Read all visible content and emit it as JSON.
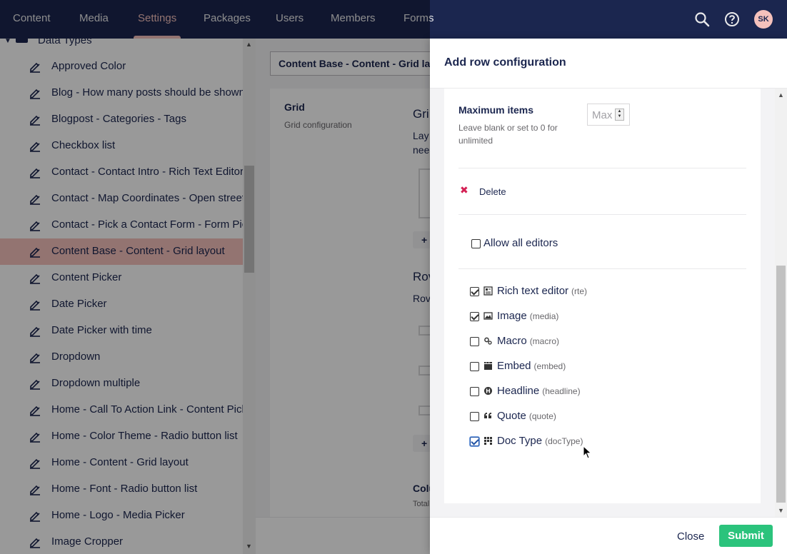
{
  "topnav": {
    "items": [
      {
        "label": "Content"
      },
      {
        "label": "Media"
      },
      {
        "label": "Settings"
      },
      {
        "label": "Packages"
      },
      {
        "label": "Users"
      },
      {
        "label": "Members"
      },
      {
        "label": "Forms"
      }
    ],
    "active": "Settings",
    "user_initials": "SK"
  },
  "tree": {
    "root_label": "Data Types",
    "items": [
      {
        "label": "Approved Color"
      },
      {
        "label": "Blog - How many posts should be shown"
      },
      {
        "label": "Blogpost - Categories - Tags"
      },
      {
        "label": "Checkbox list"
      },
      {
        "label": "Contact - Contact Intro - Rich Text Editor"
      },
      {
        "label": "Contact - Map Coordinates - Open street"
      },
      {
        "label": "Contact - Pick a Contact Form - Form Picker"
      },
      {
        "label": "Content Base - Content - Grid layout"
      },
      {
        "label": "Content Picker"
      },
      {
        "label": "Date Picker"
      },
      {
        "label": "Date Picker with time"
      },
      {
        "label": "Dropdown"
      },
      {
        "label": "Dropdown multiple"
      },
      {
        "label": "Home - Call To Action Link - Content Picker"
      },
      {
        "label": "Home - Color Theme - Radio button list"
      },
      {
        "label": "Home - Content - Grid layout"
      },
      {
        "label": "Home - Font - Radio button list"
      },
      {
        "label": "Home - Logo - Media Picker"
      },
      {
        "label": "Image Cropper"
      }
    ]
  },
  "editor": {
    "name": "Content Base - Content - Grid layout",
    "grid_label": "Grid",
    "grid_desc": "Grid configuration",
    "peek_1": "Gri",
    "peek_2": "Lay",
    "peek_3": "nee",
    "peek_4": "Rov",
    "peek_5": "Rov",
    "peek_6": "Colu",
    "peek_7": "Total",
    "plus": "+"
  },
  "dialog": {
    "title": "Add row configuration",
    "max_items_label": "Maximum items",
    "max_items_desc": "Leave blank or set to 0 for unlimited",
    "max_items_placeholder": "Max",
    "max_items_value": "",
    "delete_label": "Delete",
    "allow_all_label": "Allow all editors",
    "allow_all_checked": false,
    "editors": [
      {
        "name": "Rich text editor",
        "alias": "(rte)",
        "icon": "rte-icon",
        "checked": true
      },
      {
        "name": "Image",
        "alias": "(media)",
        "icon": "image-icon",
        "checked": true
      },
      {
        "name": "Macro",
        "alias": "(macro)",
        "icon": "macro-icon",
        "checked": false
      },
      {
        "name": "Embed",
        "alias": "(embed)",
        "icon": "embed-icon",
        "checked": false
      },
      {
        "name": "Headline",
        "alias": "(headline)",
        "icon": "headline-icon",
        "checked": false
      },
      {
        "name": "Quote",
        "alias": "(quote)",
        "icon": "quote-icon",
        "checked": false
      },
      {
        "name": "Doc Type",
        "alias": "(docType)",
        "icon": "doctype-icon",
        "checked": true
      }
    ],
    "close_label": "Close",
    "submit_label": "Submit"
  },
  "colors": {
    "nav_bg": "#1b264f",
    "accent": "#f5c1bc",
    "submit": "#2bc37c",
    "delete": "#d42054"
  }
}
